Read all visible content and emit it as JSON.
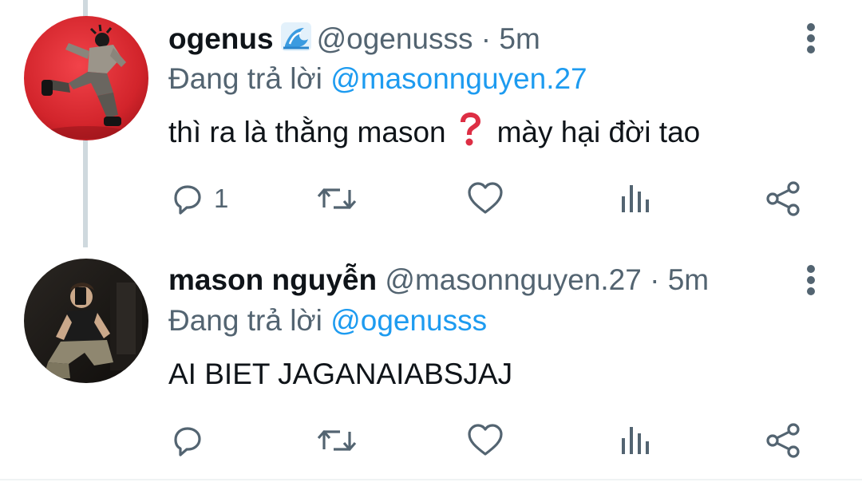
{
  "colors": {
    "accent": "#1d9bf0",
    "secondary_text": "#536471",
    "primary_text": "#0f1419",
    "thread_line": "#cfd9de"
  },
  "tweets": [
    {
      "display_name": "ogenus",
      "badge_icon": "water-wave-emoji",
      "handle": "@ogenusss",
      "separator": "·",
      "time": "5m",
      "reply_prefix": "Đang trả lời",
      "reply_to": "@masonnguyen.27",
      "text_before_emoji": "thì ra là thằng mason",
      "emoji": "red-question-mark-emoji",
      "text_after_emoji": "mày hại đời tao",
      "reply_count": "1",
      "more_icon": "vertical-ellipsis-icon"
    },
    {
      "display_name": "mason nguyễn",
      "handle": "@masonnguyen.27",
      "separator": "·",
      "time": "5m",
      "reply_prefix": "Đang trả lời",
      "reply_to": "@ogenusss",
      "text": "AI BIET JAGANAIABSJAJ",
      "reply_count": "",
      "more_icon": "vertical-ellipsis-icon"
    }
  ],
  "action_icons": [
    "reply-icon",
    "retweet-icon",
    "like-icon",
    "views-icon",
    "share-icon"
  ]
}
